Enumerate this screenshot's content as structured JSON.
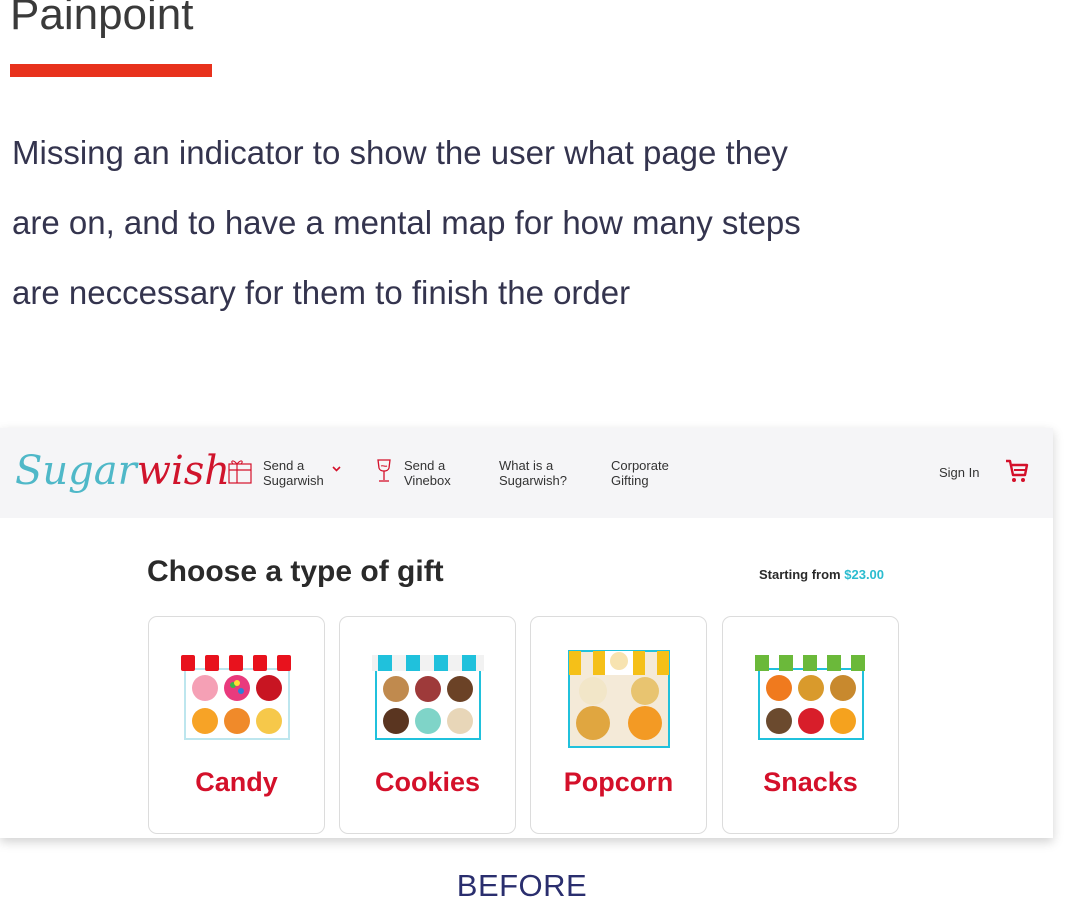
{
  "page": {
    "title": "Painpoint",
    "description_lines": [
      "Missing an indicator to show the user what page they",
      "are on, and to have a mental map for how many steps",
      "are neccessary for them to finish the order"
    ],
    "caption": "BEFORE",
    "accent_color": "#e8321d"
  },
  "site": {
    "logo": {
      "part1": "Sugar",
      "part2": "wish"
    },
    "nav": [
      {
        "line1": "Send a",
        "line2": "Sugarwish",
        "icon": "gift-box-icon",
        "has_dropdown": true
      },
      {
        "line1": "Send a",
        "line2": "Vinebox",
        "icon": "wine-glass-icon",
        "has_dropdown": false
      },
      {
        "line1": "What is a",
        "line2": "Sugarwish?"
      },
      {
        "line1": "Corporate",
        "line2": "Gifting"
      }
    ],
    "sign_in": "Sign In",
    "cart_icon": "cart-icon",
    "heading": "Choose a type of gift",
    "starting_from_label": "Starting from",
    "starting_price": "$23.00",
    "price_color": "#2bbccf",
    "brand_red": "#d4102a",
    "cards": [
      {
        "label": "Candy",
        "awning_color": "#e8121d"
      },
      {
        "label": "Cookies",
        "awning_color": "#20c1dc"
      },
      {
        "label": "Popcorn",
        "awning_color": "#f5c018"
      },
      {
        "label": "Snacks",
        "awning_color": "#6bb93a"
      }
    ]
  }
}
